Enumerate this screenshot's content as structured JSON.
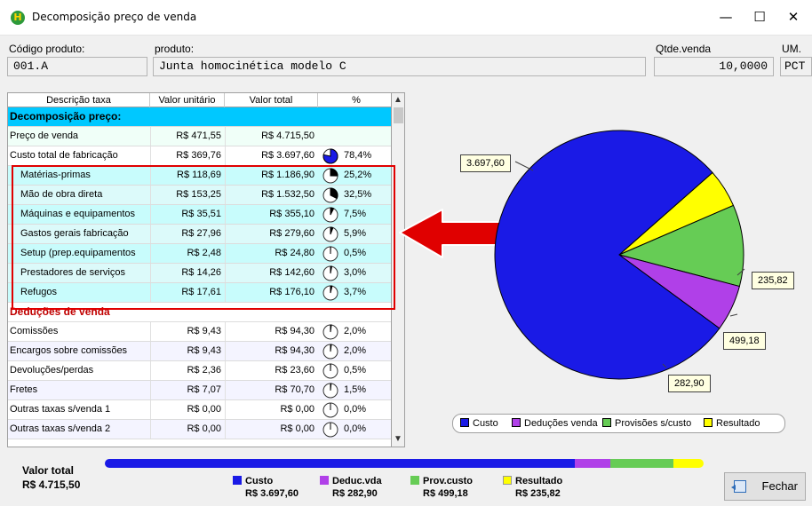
{
  "window": {
    "title": "Decomposição preço de venda",
    "app_icon": "H",
    "minimize": "—",
    "maximize": "☐",
    "close": "✕"
  },
  "header": {
    "codigo_label": "Código produto:",
    "codigo_value": "001.A",
    "produto_label": "produto:",
    "produto_value": "Junta homocinética modelo C",
    "qtde_label": "Qtde.venda",
    "qtde_value": "10,0000",
    "um_label": "UM.",
    "um_value": "PCT"
  },
  "grid": {
    "columns": [
      "Descrição taxa",
      "Valor unitário",
      "Valor total",
      "%"
    ],
    "rows": [
      {
        "desc": "Decomposição preço:",
        "type": "section",
        "bg": "#00c8ff"
      },
      {
        "desc": "Preço de venda",
        "unit": "R$ 471,55",
        "total": "R$ 4.715,50",
        "pct": "",
        "bg": "#f0fff8"
      },
      {
        "desc": "Custo total de fabricação",
        "unit": "R$ 369,76",
        "total": "R$ 3.697,60",
        "pct": "78,4%",
        "frac": 0.784,
        "filled": true,
        "bg": "#ffffff"
      },
      {
        "desc": "Matérias-primas",
        "unit": "R$ 118,69",
        "total": "R$ 1.186,90",
        "pct": "25,2%",
        "frac": 0.252,
        "sub": true,
        "bg": "#c8fcfc"
      },
      {
        "desc": "Mão de obra direta",
        "unit": "R$ 153,25",
        "total": "R$ 1.532,50",
        "pct": "32,5%",
        "frac": 0.325,
        "sub": true,
        "bg": "#dcfafa"
      },
      {
        "desc": "Máquinas e equipamentos",
        "unit": "R$ 35,51",
        "total": "R$ 355,10",
        "pct": "7,5%",
        "frac": 0.075,
        "sub": true,
        "bg": "#c8fcfc"
      },
      {
        "desc": "Gastos gerais fabricação",
        "unit": "R$ 27,96",
        "total": "R$ 279,60",
        "pct": "5,9%",
        "frac": 0.059,
        "sub": true,
        "bg": "#dcfafa"
      },
      {
        "desc": "Setup (prep.equipamentos",
        "unit": "R$ 2,48",
        "total": "R$ 24,80",
        "pct": "0,5%",
        "frac": 0.005,
        "sub": true,
        "bg": "#c8fcfc"
      },
      {
        "desc": "Prestadores de serviços",
        "unit": "R$ 14,26",
        "total": "R$ 142,60",
        "pct": "3,0%",
        "frac": 0.03,
        "sub": true,
        "bg": "#dcfafa"
      },
      {
        "desc": "Refugos",
        "unit": "R$ 17,61",
        "total": "R$ 176,10",
        "pct": "3,7%",
        "frac": 0.037,
        "sub": true,
        "bg": "#c8fcfc"
      },
      {
        "desc": "Deduções de venda",
        "type": "section",
        "bg": "#ffffff",
        "color": "#c00000"
      },
      {
        "desc": "Comissões",
        "unit": "R$ 9,43",
        "total": "R$ 94,30",
        "pct": "2,0%",
        "frac": 0.02,
        "bg": "#ffffff"
      },
      {
        "desc": "Encargos sobre comissões",
        "unit": "R$ 9,43",
        "total": "R$ 94,30",
        "pct": "2,0%",
        "frac": 0.02,
        "bg": "#f4f4ff"
      },
      {
        "desc": "Devoluções/perdas",
        "unit": "R$ 2,36",
        "total": "R$ 23,60",
        "pct": "0,5%",
        "frac": 0.005,
        "bg": "#ffffff"
      },
      {
        "desc": "Fretes",
        "unit": "R$ 7,07",
        "total": "R$ 70,70",
        "pct": "1,5%",
        "frac": 0.015,
        "bg": "#f4f4ff"
      },
      {
        "desc": "Outras taxas s/venda 1",
        "unit": "R$ 0,00",
        "total": "R$ 0,00",
        "pct": "0,0%",
        "frac": 0,
        "bg": "#ffffff"
      },
      {
        "desc": "Outras taxas s/venda 2",
        "unit": "R$ 0,00",
        "total": "R$ 0,00",
        "pct": "0,0%",
        "frac": 0,
        "bg": "#f4f4ff"
      }
    ]
  },
  "chart_data": {
    "type": "pie",
    "slices": [
      {
        "name": "Custo",
        "value": 3697.6,
        "label": "3.697,60",
        "color": "#1a1ae6"
      },
      {
        "name": "Deduções venda",
        "value": 282.9,
        "label": "282,90",
        "color": "#b040e8"
      },
      {
        "name": "Provisões s/custo",
        "value": 499.18,
        "label": "499,18",
        "color": "#66cc55"
      },
      {
        "name": "Resultado",
        "value": 235.82,
        "label": "235,82",
        "color": "#ffff00"
      }
    ],
    "legend_placement": "bottom"
  },
  "footer": {
    "total_label": "Valor total",
    "total_value": "R$ 4.715,50",
    "legend": [
      {
        "name": "Custo",
        "value": "R$ 3.697,60",
        "color": "#1a1ae6"
      },
      {
        "name": "Deduc.vda",
        "value": "R$ 282,90",
        "color": "#b040e8"
      },
      {
        "name": "Prov.custo",
        "value": "R$ 499,18",
        "color": "#66cc55"
      },
      {
        "name": "Resultado",
        "value": "R$ 235,82",
        "color": "#ffff00"
      }
    ],
    "fechar_label": "Fechar"
  }
}
